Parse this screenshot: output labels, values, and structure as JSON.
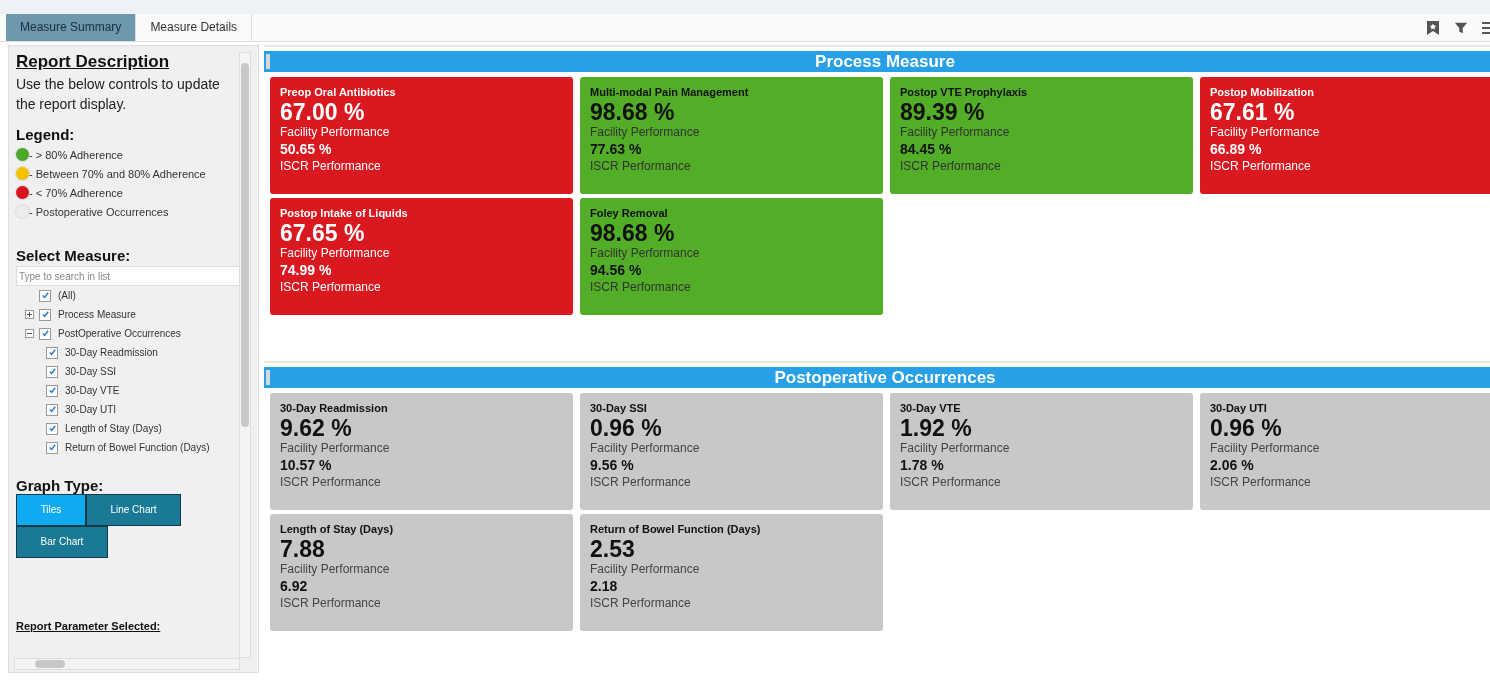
{
  "tabs": [
    {
      "label": "Measure Summary",
      "selected": true
    },
    {
      "label": "Measure Details",
      "selected": false
    }
  ],
  "sidebar": {
    "title": "Report Description",
    "description": "Use the below controls to update the report display.",
    "legend_title": "Legend:",
    "legend": [
      {
        "label": "- > 80% Adherence",
        "color": "#4aa82a"
      },
      {
        "label": "- Between 70% and 80% Adherence",
        "color": "#f2c200"
      },
      {
        "label": "- < 70% Adherence",
        "color": "#d9141e"
      },
      {
        "label": "- Postoperative Occurrences",
        "color": "#ececec"
      }
    ],
    "select_title": "Select Measure:",
    "search": {
      "placeholder": "Type to search in list"
    },
    "tree": [
      {
        "label": "(All)",
        "checked": true
      },
      {
        "label": "Process Measure",
        "checked": true,
        "expanded": false
      },
      {
        "label": "PostOperative Occurrences",
        "checked": true,
        "expanded": true,
        "children": [
          {
            "label": "30-Day Readmission",
            "checked": true
          },
          {
            "label": "30-Day SSI",
            "checked": true
          },
          {
            "label": "30-Day VTE",
            "checked": true
          },
          {
            "label": "30-Day UTI",
            "checked": true
          },
          {
            "label": "Length of Stay (Days)",
            "checked": true
          },
          {
            "label": "Return of Bowel Function (Days)",
            "checked": true
          }
        ]
      }
    ],
    "graph_type_title": "Graph Type:",
    "graph_types": [
      {
        "label": "Tiles",
        "selected": true
      },
      {
        "label": "Line Chart",
        "selected": false
      },
      {
        "label": "Bar Chart",
        "selected": false
      }
    ],
    "parameter_title": "Report Parameter Selected:"
  },
  "sections": [
    {
      "title": "Process Measure",
      "tiles": [
        {
          "title": "Preop Oral Antibiotics",
          "value": "67.00 %",
          "value_label": "Facility Performance",
          "compare": "50.65 %",
          "compare_label": "ISCR Performance",
          "color": "#d9181f"
        },
        {
          "title": "Multi-modal Pain Management",
          "value": "98.68 %",
          "value_label": "Facility Performance",
          "compare": "77.63 %",
          "compare_label": "ISCR Performance",
          "color": "#52ad27"
        },
        {
          "title": "Postop VTE Prophylaxis",
          "value": "89.39 %",
          "value_label": "Facility Performance",
          "compare": "84.45 %",
          "compare_label": "ISCR Performance",
          "color": "#52ad27"
        },
        {
          "title": "Postop Mobilization",
          "value": "67.61 %",
          "value_label": "Facility Performance",
          "compare": "66.89 %",
          "compare_label": "ISCR Performance",
          "color": "#d9181f"
        },
        {
          "title": "Postop Intake of Liquids",
          "value": "67.65 %",
          "value_label": "Facility Performance",
          "compare": "74.99 %",
          "compare_label": "ISCR Performance",
          "color": "#d9181f"
        },
        {
          "title": "Foley Removal",
          "value": "98.68 %",
          "value_label": "Facility Performance",
          "compare": "94.56 %",
          "compare_label": "ISCR Performance",
          "color": "#52ad27"
        }
      ]
    },
    {
      "title": "Postoperative Occurrences",
      "tiles": [
        {
          "title": "30-Day Readmission",
          "value": "9.62 %",
          "value_label": "Facility Performance",
          "compare": "10.57 %",
          "compare_label": "ISCR Performance",
          "color": "#c8c8c8"
        },
        {
          "title": "30-Day SSI",
          "value": "0.96 %",
          "value_label": "Facility Performance",
          "compare": "9.56 %",
          "compare_label": "ISCR Performance",
          "color": "#c8c8c8"
        },
        {
          "title": "30-Day VTE",
          "value": "1.92 %",
          "value_label": "Facility Performance",
          "compare": "1.78 %",
          "compare_label": "ISCR Performance",
          "color": "#c8c8c8"
        },
        {
          "title": "30-Day UTI",
          "value": "0.96 %",
          "value_label": "Facility Performance",
          "compare": "2.06 %",
          "compare_label": "ISCR Performance",
          "color": "#c8c8c8"
        },
        {
          "title": "Length of Stay (Days)",
          "value": "7.88",
          "value_label": "Facility Performance",
          "compare": "6.92",
          "compare_label": "ISCR Performance",
          "color": "#c8c8c8"
        },
        {
          "title": "Return of Bowel Function (Days)",
          "value": "2.53",
          "value_label": "Facility Performance",
          "compare": "2.18",
          "compare_label": "ISCR Performance",
          "color": "#c8c8c8"
        }
      ]
    }
  ]
}
